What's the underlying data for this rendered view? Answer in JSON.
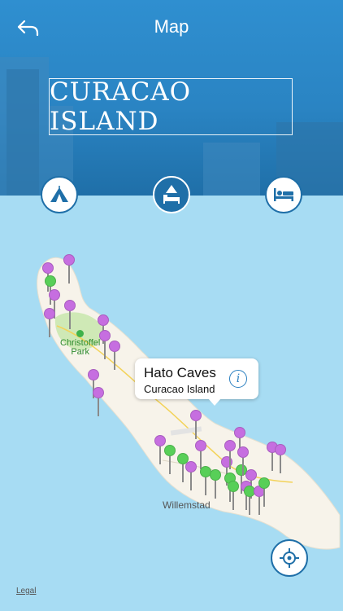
{
  "nav": {
    "title": "Map",
    "back_icon": "back-arrow-icon"
  },
  "hero": {
    "title": "CURACAO ISLAND"
  },
  "categories": [
    {
      "name": "attractions",
      "icon": "tent-icon",
      "active": false
    },
    {
      "name": "lodging-activities",
      "icon": "tent-bed-icon",
      "active": true
    },
    {
      "name": "hotels",
      "icon": "bed-icon",
      "active": false
    }
  ],
  "map": {
    "labels": {
      "park_line1": "Christoffel",
      "park_line2": "Park",
      "city": "Willemstad",
      "legal": "Legal"
    },
    "callout": {
      "title": "Hato Caves",
      "subtitle": "Curacao Island",
      "info_icon": "info-icon"
    },
    "locate_icon": "crosshair-icon",
    "colors": {
      "sea": "#a7dcf3",
      "land": "#f7f3ea",
      "accent": "#1f6fa8",
      "pin_purple": "#c66ee0",
      "pin_green": "#58cf58"
    }
  }
}
